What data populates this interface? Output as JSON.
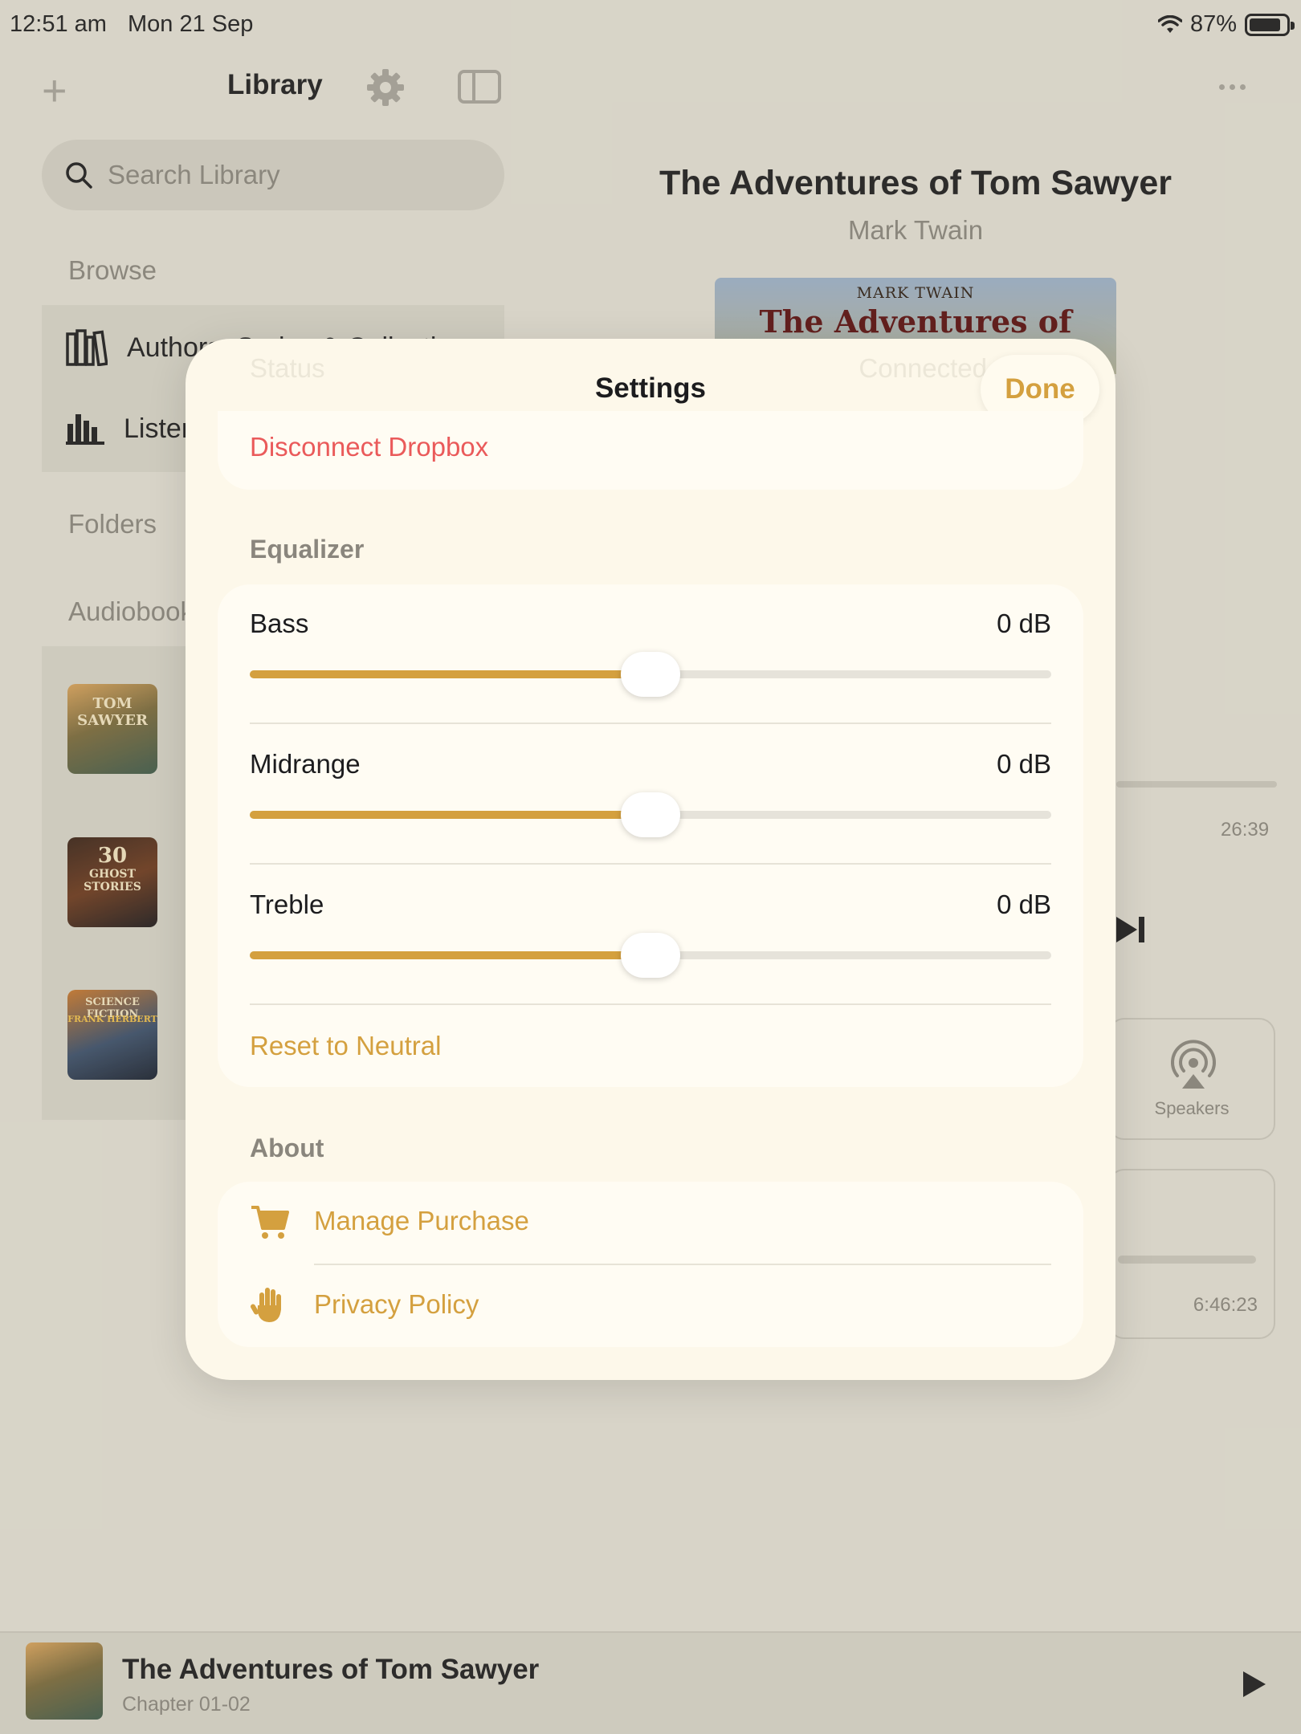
{
  "status_bar": {
    "time": "12:51 am",
    "date": "Mon 21 Sep",
    "battery": "87%"
  },
  "sidebar": {
    "title": "Library",
    "search_placeholder": "Search Library",
    "browse_header": "Browse",
    "browse_items": [
      {
        "label": "Authors, Series & Collections",
        "icon": "books-icon"
      },
      {
        "label": "Listening Stats",
        "icon": "bar-chart-icon"
      }
    ],
    "folders_header": "Folders",
    "audiobooks_header": "Audiobooks"
  },
  "now_playing": {
    "title": "The Adventures of Tom Sawyer",
    "author": "Mark Twain",
    "art_author": "MARK TWAIN",
    "art_title": "The Adventures of",
    "time_remaining": "26:39",
    "speakers_label": "Speakers",
    "sleep_timer": "6:46:23"
  },
  "mini_player": {
    "title": "The Adventures of Tom Sawyer",
    "subtitle": "Chapter 01-02"
  },
  "settings_modal": {
    "title": "Settings",
    "done_label": "Done",
    "hidden_status_label": "Status",
    "hidden_status_value": "Connected",
    "disconnect_label": "Disconnect Dropbox",
    "equalizer_header": "Equalizer",
    "equalizer": [
      {
        "label": "Bass",
        "value": "0 dB",
        "position": 0.5
      },
      {
        "label": "Midrange",
        "value": "0 dB",
        "position": 0.5
      },
      {
        "label": "Treble",
        "value": "0 dB",
        "position": 0.5
      }
    ],
    "reset_label": "Reset to Neutral",
    "about_header": "About",
    "about_items": [
      {
        "label": "Manage Purchase",
        "icon": "cart-icon"
      },
      {
        "label": "Privacy Policy",
        "icon": "hand-icon"
      }
    ]
  },
  "colors": {
    "accent": "#d4a03f",
    "destructive": "#ea5a5a",
    "modal_bg": "#fdf8ea",
    "page_bg": "#e3e0d4"
  }
}
